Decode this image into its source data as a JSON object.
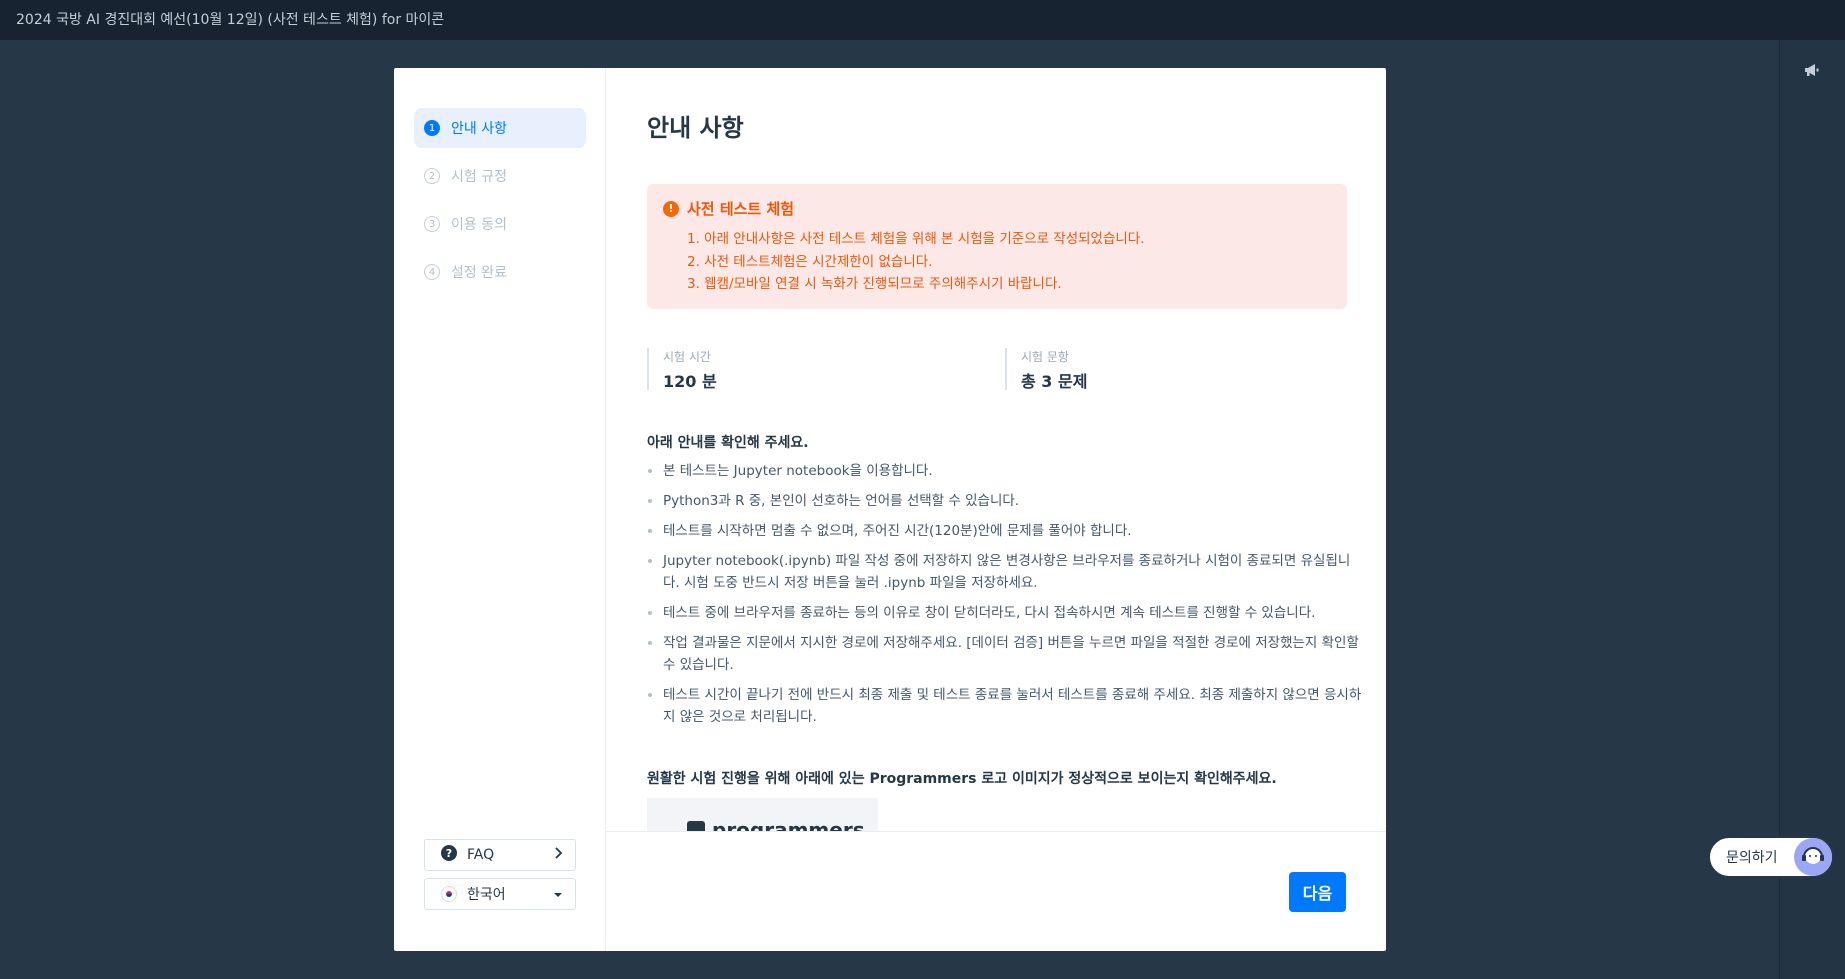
{
  "topbar": {
    "title": "2024 국방 AI 경진대회 예선(10월 12일) (사전 테스트 체험) for 마이콘"
  },
  "sidebar": {
    "steps": [
      {
        "num": "1",
        "label": "안내 사항",
        "active": true
      },
      {
        "num": "2",
        "label": "시험 규정",
        "active": false
      },
      {
        "num": "3",
        "label": "이용 동의",
        "active": false
      },
      {
        "num": "4",
        "label": "설정 완료",
        "active": false
      }
    ],
    "faq_label": "FAQ",
    "language_label": "한국어"
  },
  "main": {
    "title": "안내 사항",
    "alert": {
      "title": "사전 테스트 체험",
      "items": [
        "1. 아래 안내사항은 사전 테스트 체험을 위해 본 시험을 기준으로 작성되었습니다.",
        "2. 사전 테스트체험은 시간제한이 없습니다.",
        "3. 웹캠/모바일 연결 시 녹화가 진행되므로 주의해주시기 바랍니다."
      ]
    },
    "stats": [
      {
        "label": "시험 시간",
        "value": "120 분"
      },
      {
        "label": "시험 문항",
        "value": "총 3 문제"
      }
    ],
    "notice_title": "아래 안내를 확인해 주세요.",
    "notices": [
      "본 테스트는 Jupyter notebook을 이용합니다.",
      "Python3과 R 중, 본인이 선호하는 언어를 선택할 수 있습니다.",
      "테스트를 시작하면 멈출 수 없으며, 주어진 시간(120분)안에 문제를 풀어야 합니다.",
      "Jupyter notebook(.ipynb) 파일 작성 중에 저장하지 않은 변경사항은 브라우저를 종료하거나 시험이 종료되면 유실됩니다. 시험 도중 반드시 저장 버튼을 눌러 .ipynb 파일을 저장하세요.",
      "테스트 중에 브라우저를 종료하는 등의 이유로 창이 닫히더라도, 다시 접속하시면 계속 테스트를 진행할 수 있습니다.",
      "작업 결과물은 지문에서 지시한 경로에 저장해주세요. [데이터 검증] 버튼을 누르면 파일을 적절한 경로에 저장했는지 확인할 수 있습니다.",
      "테스트 시간이 끝나기 전에 반드시 최종 제출 및 테스트 종료를 눌러서 테스트를 종료해 주세요. 최종 제출하지 않으면 응시하지 않은 것으로 처리됩니다."
    ],
    "logo_check": "원활한 시험 진행을 위해 아래에 있는 Programmers 로고 이미지가 정상적으로 보이는지 확인해주세요.",
    "logo_brand": "programmers"
  },
  "footer": {
    "next_label": "다음"
  },
  "help": {
    "label": "문의하기"
  },
  "colors": {
    "accent": "#0078ff",
    "alert_bg": "#fce8e6",
    "alert_text": "#e8590c",
    "background": "#263747"
  }
}
